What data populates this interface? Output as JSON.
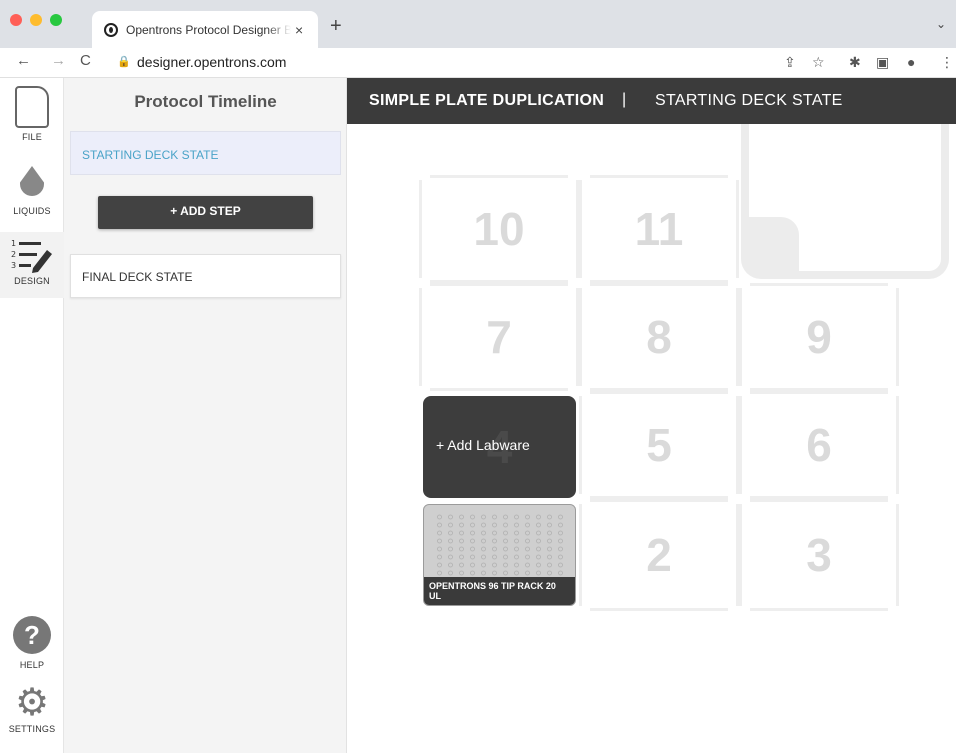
{
  "browser": {
    "tab_title": "Opentrons Protocol Designer BETA",
    "tab_close": "×",
    "new_tab": "+",
    "tab_menu": "⌄",
    "url": "designer.opentrons.com",
    "nav": {
      "back": "←",
      "forward": "→",
      "reload": "C"
    }
  },
  "iconbar": {
    "file": "FILE",
    "liquids": "LIQUIDS",
    "design": "DESIGN",
    "help": "HELP",
    "help_glyph": "?",
    "settings": "SETTINGS",
    "settings_glyph": "⚙"
  },
  "timeline": {
    "title": "Protocol Timeline",
    "starting": "STARTING DECK STATE",
    "add_step": "+ ADD STEP",
    "final": "FINAL DECK STATE"
  },
  "deck": {
    "protocol_name": "SIMPLE PLATE DUPLICATION",
    "separator": "|",
    "state": "STARTING DECK STATE",
    "slots": [
      "10",
      "11",
      "7",
      "8",
      "9",
      "4",
      "5",
      "6",
      "2",
      "3"
    ],
    "add_labware": "+ Add Labware",
    "tiprack_label": "OPENTRONS 96 TIP RACK 20 UL"
  },
  "colors": {
    "header_bg": "#3b3b3b",
    "accent_blue": "#4aa3c8",
    "button_dark": "#424242"
  }
}
